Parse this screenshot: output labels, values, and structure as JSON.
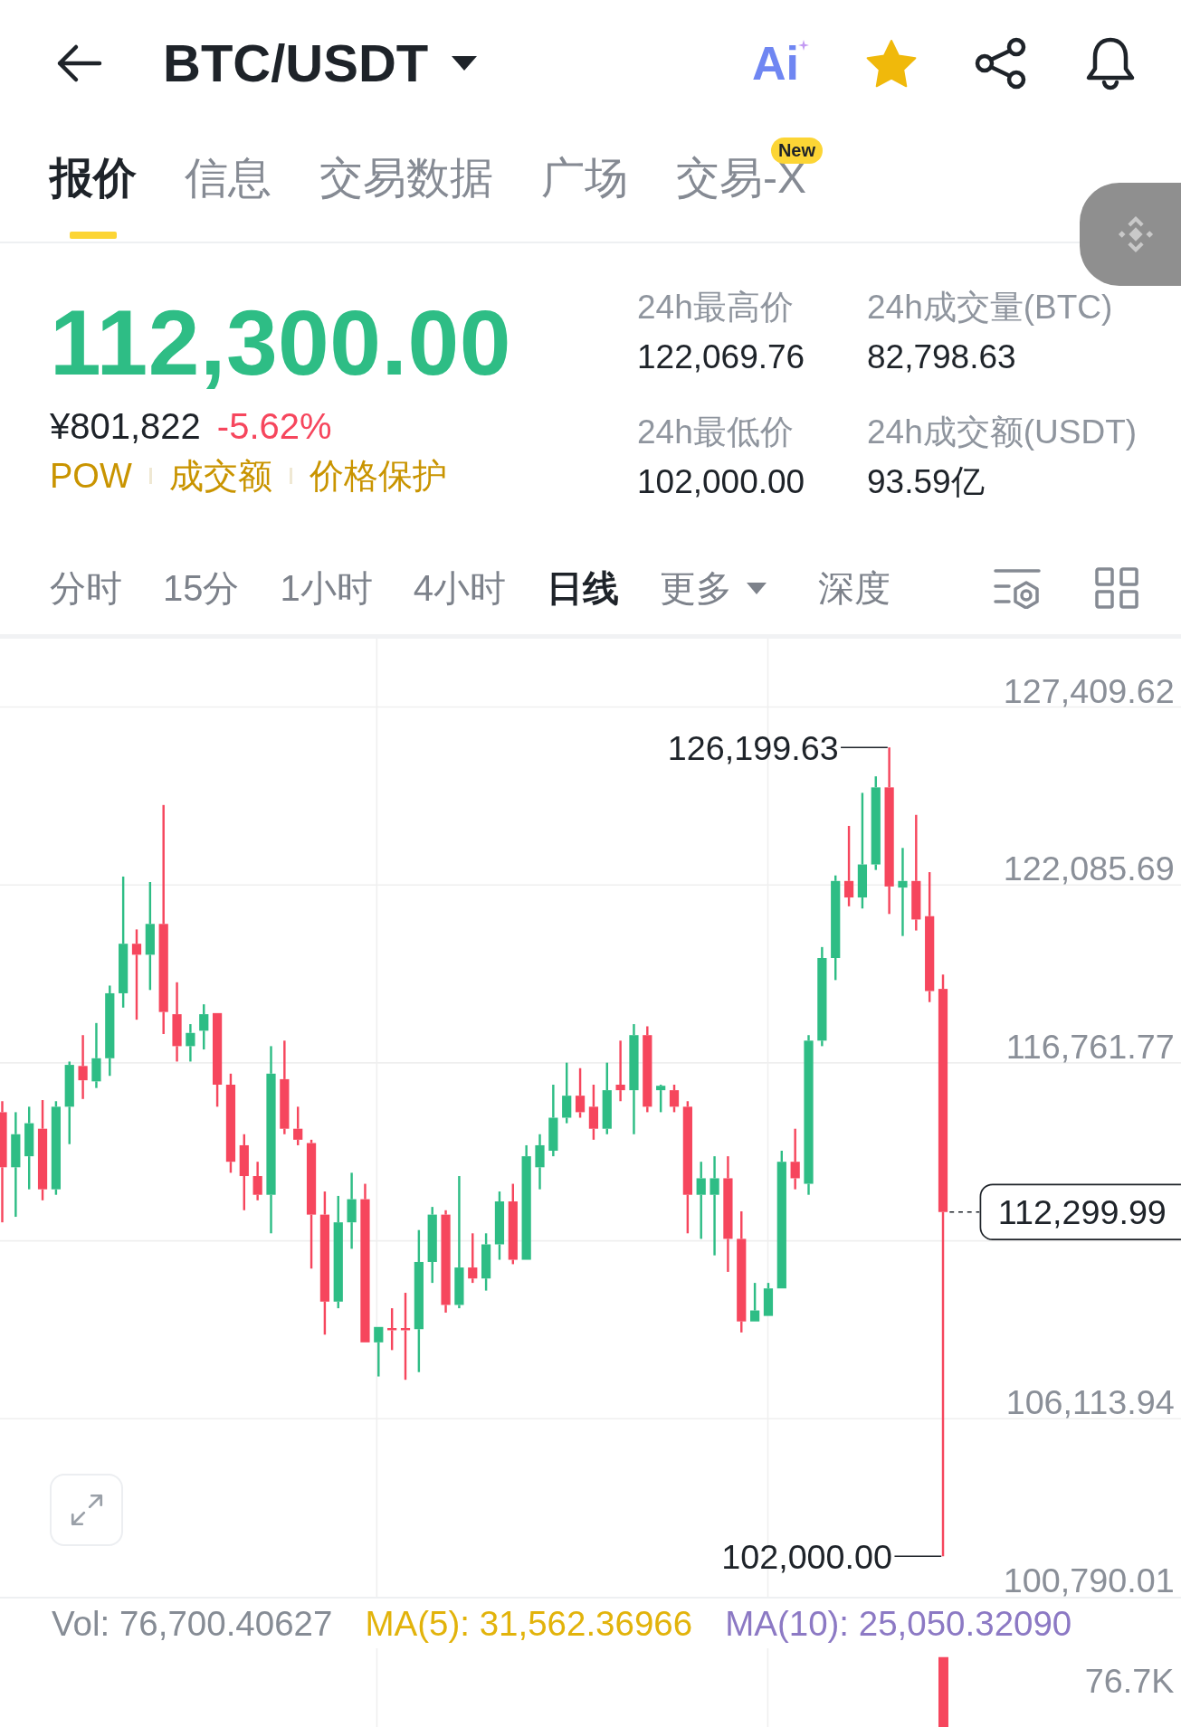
{
  "header": {
    "pair": "BTC/USDT",
    "ai_label": "Ai",
    "favorited": true
  },
  "tabs": [
    {
      "label": "报价",
      "selected": true
    },
    {
      "label": "信息",
      "selected": false
    },
    {
      "label": "交易数据",
      "selected": false
    },
    {
      "label": "广场",
      "selected": false
    },
    {
      "label": "交易-X",
      "selected": false,
      "badge": "New"
    }
  ],
  "quote": {
    "last_price": "112,300.00",
    "fiat_price": "¥801,822",
    "change": "-5.62%",
    "tags": [
      "POW",
      "成交额",
      "价格保护"
    ]
  },
  "stats": [
    {
      "label": "24h最高价",
      "value": "122,069.76"
    },
    {
      "label": "24h成交量(BTC)",
      "value": "82,798.63"
    },
    {
      "label": "24h最低价",
      "value": "102,000.00"
    },
    {
      "label": "24h成交额(USDT)",
      "value": "93.59亿"
    }
  ],
  "intervals": [
    {
      "label": "分时",
      "selected": false,
      "kind": "option"
    },
    {
      "label": "15分",
      "selected": false,
      "kind": "option"
    },
    {
      "label": "1小时",
      "selected": false,
      "kind": "option"
    },
    {
      "label": "4小时",
      "selected": false,
      "kind": "option"
    },
    {
      "label": "日线",
      "selected": true,
      "kind": "option"
    },
    {
      "label": "更多",
      "selected": false,
      "kind": "dropdown"
    },
    {
      "label": "深度",
      "selected": false,
      "kind": "option"
    }
  ],
  "chart": {
    "chart_data": {
      "type": "candlestick",
      "ohlc": [
        [
          115286,
          115615,
          111991,
          113638
        ],
        [
          113638,
          115286,
          112156,
          114627
        ],
        [
          113968,
          115450,
          112979,
          114956
        ],
        [
          114791,
          115648,
          112650,
          112979
        ],
        [
          112979,
          115615,
          112815,
          115450
        ],
        [
          115450,
          116801,
          114330,
          116702
        ],
        [
          116669,
          117592,
          115681,
          116241
        ],
        [
          116208,
          117954,
          116010,
          116900
        ],
        [
          116900,
          119074,
          116373,
          118844
        ],
        [
          118844,
          122336,
          118415,
          120326
        ],
        [
          120326,
          120754,
          118053,
          119997
        ],
        [
          119997,
          122171,
          118942,
          120919
        ],
        [
          120919,
          124477,
          117625,
          118284
        ],
        [
          118218,
          119173,
          116801,
          117262
        ],
        [
          117262,
          117921,
          116801,
          117658
        ],
        [
          117724,
          118514,
          117163,
          118218
        ],
        [
          118251,
          118251,
          115450,
          116109
        ],
        [
          116109,
          116439,
          113474,
          113803
        ],
        [
          114297,
          114627,
          112353,
          113375
        ],
        [
          113375,
          113803,
          112650,
          112815
        ],
        [
          112815,
          117262,
          111662,
          116439
        ],
        [
          116274,
          117427,
          114627,
          114791
        ],
        [
          114791,
          115450,
          114297,
          114462
        ],
        [
          114363,
          114462,
          110607,
          112222
        ],
        [
          112222,
          112914,
          108631,
          109619
        ],
        [
          109619,
          112782,
          109421,
          111991
        ],
        [
          111991,
          113474,
          111200,
          112683
        ],
        [
          112683,
          113144,
          108400,
          108400
        ],
        [
          108400,
          108861,
          107379,
          108861
        ],
        [
          108828,
          109421,
          108169,
          108762
        ],
        [
          108828,
          109883,
          107280,
          108762
        ],
        [
          108795,
          111760,
          107510,
          110805
        ],
        [
          110805,
          112452,
          110179,
          112222
        ],
        [
          112222,
          112353,
          109290,
          109520
        ],
        [
          109520,
          113375,
          109421,
          110640
        ],
        [
          110640,
          111662,
          110179,
          110311
        ],
        [
          110311,
          111662,
          109949,
          111332
        ],
        [
          111332,
          112914,
          110871,
          112617
        ],
        [
          112617,
          113144,
          110739,
          110871
        ],
        [
          110871,
          114297,
          110871,
          113968
        ],
        [
          113638,
          114627,
          112979,
          114297
        ],
        [
          114133,
          116109,
          113968,
          115121
        ],
        [
          115121,
          116768,
          114956,
          115780
        ],
        [
          115780,
          116603,
          115121,
          115286
        ],
        [
          115450,
          116109,
          114462,
          114791
        ],
        [
          114791,
          116768,
          114627,
          115944
        ],
        [
          116109,
          117427,
          115615,
          115944
        ],
        [
          115944,
          117921,
          114627,
          117592
        ],
        [
          117592,
          117855,
          115286,
          115450
        ],
        [
          115944,
          116109,
          115286,
          116076
        ],
        [
          115944,
          116109,
          115286,
          115450
        ],
        [
          115450,
          115615,
          111662,
          112815
        ],
        [
          112815,
          113803,
          111497,
          113309
        ],
        [
          112815,
          113968,
          111003,
          113309
        ],
        [
          113309,
          113968,
          110509,
          111497
        ],
        [
          111497,
          112321,
          108697,
          109026
        ],
        [
          109026,
          110179,
          109026,
          109355
        ],
        [
          109191,
          110179,
          109191,
          110014
        ],
        [
          110014,
          114133,
          110014,
          113803
        ],
        [
          113803,
          114791,
          112979,
          113309
        ],
        [
          113144,
          117592,
          112815,
          117427
        ],
        [
          117427,
          120227,
          117262,
          119898
        ],
        [
          119898,
          122369,
          119239,
          122204
        ],
        [
          122204,
          123851,
          121446,
          121710
        ],
        [
          121710,
          124840,
          121380,
          122698
        ],
        [
          122698,
          125334,
          122533,
          125004
        ],
        [
          125004,
          126199.63,
          121216,
          122039
        ],
        [
          122006,
          123192,
          120557,
          122204
        ],
        [
          122204,
          124181,
          120722,
          121051
        ],
        [
          121150,
          122468,
          118580,
          118910
        ],
        [
          118975,
          119404,
          102000,
          112299.99
        ]
      ],
      "ylim": [
        100790.01,
        129452.2
      ],
      "yticks": [
        {
          "value": 127409.62,
          "label": "127,409.62"
        },
        {
          "value": 122085.69,
          "label": "122,085.69"
        },
        {
          "value": 116761.77,
          "label": "116,761.77"
        },
        {
          "value": 106113.94,
          "label": "106,113.94"
        },
        {
          "value": 100790.01,
          "label": "100,790.01"
        }
      ],
      "grid": true,
      "annotations": [
        "126,199.63",
        "112,299.99",
        "102,000.00"
      ]
    }
  },
  "volume": {
    "legend": [
      {
        "text": "Vol: 76,700.40627",
        "color": "#868c95"
      },
      {
        "text": "MA(5): 31,562.36966",
        "color": "#e2b30b"
      },
      {
        "text": "MA(10): 25,050.32090",
        "color": "#8c79c4"
      }
    ],
    "axis_label": "76.7K"
  }
}
